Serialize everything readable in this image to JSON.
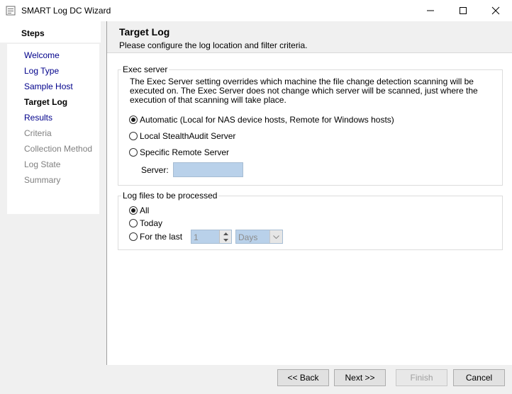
{
  "window": {
    "title": "SMART Log DC Wizard",
    "icons": [
      "app-icon",
      "minimize-icon",
      "maximize-icon",
      "close-icon"
    ]
  },
  "steps": {
    "title": "Steps",
    "items": [
      {
        "label": "Welcome",
        "state": "done"
      },
      {
        "label": "Log Type",
        "state": "done"
      },
      {
        "label": "Sample Host",
        "state": "done"
      },
      {
        "label": "Target Log",
        "state": "current"
      },
      {
        "label": "Results",
        "state": "done"
      },
      {
        "label": "Criteria",
        "state": "future"
      },
      {
        "label": "Collection Method",
        "state": "future"
      },
      {
        "label": "Log State",
        "state": "future"
      },
      {
        "label": "Summary",
        "state": "future"
      }
    ]
  },
  "header": {
    "title": "Target Log",
    "subtitle": "Please configure the log location and filter criteria."
  },
  "exec_server": {
    "legend": "Exec server",
    "description": "The Exec Server setting overrides which machine the file change detection scanning will be executed on. The Exec Server does not change which server will be scanned, just where the execution of that scanning will take place.",
    "options": [
      {
        "label": "Automatic  (Local for NAS device hosts, Remote for Windows hosts)",
        "selected": true
      },
      {
        "label": "Local StealthAudit Server",
        "selected": false
      },
      {
        "label": "Specific Remote Server",
        "selected": false
      }
    ],
    "server_label": "Server:",
    "server_value": ""
  },
  "log_files": {
    "legend": "Log files to be processed",
    "options": [
      {
        "label": "All",
        "selected": true
      },
      {
        "label": "Today",
        "selected": false
      },
      {
        "label": "For the last",
        "selected": false
      }
    ],
    "count_value": "1",
    "unit_value": "Days"
  },
  "footer": {
    "back": "<< Back",
    "next": "Next >>",
    "finish": "Finish",
    "cancel": "Cancel"
  },
  "colors": {
    "panel_bg": "#f0f0f0",
    "disabled_field_bg": "#b9d1ea",
    "done_step": "#00008b",
    "future_step": "#808080"
  }
}
